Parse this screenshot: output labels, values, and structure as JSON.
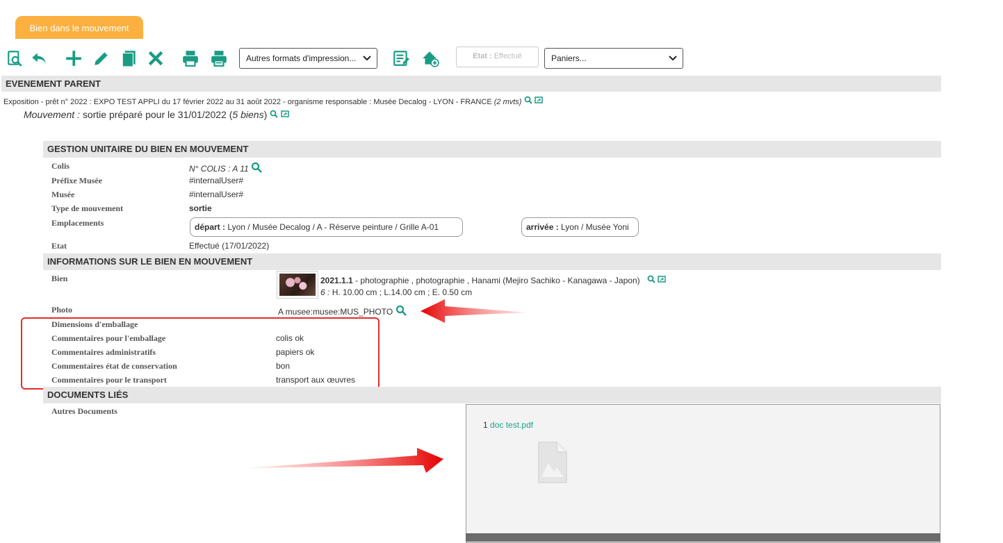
{
  "tab": {
    "label": "Bien dans le mouvement"
  },
  "toolbar": {
    "icons": [
      "preview-search-icon",
      "back-icon",
      "add-icon",
      "edit-icon",
      "copy-icon",
      "delete-icon",
      "print-icon",
      "print-alt-icon"
    ],
    "print_formats_select": "Autres formats d'impression...",
    "list_icon": "list-edit-icon",
    "home_add_icon": "home-add-icon",
    "etat_label": "Etat :",
    "etat_value": "Effectué",
    "paniers_select": "Paniers..."
  },
  "evenement_parent": {
    "header": "EVENEMENT PARENT",
    "exposition_text": "Exposition - prêt n° 2022 : EXPO TEST APPLI du 17 février 2022 au 31 août 2022 - organisme responsable : Musée Decalog - LYON - FRANCE",
    "exposition_mvts": "(2 mvts)",
    "mouvement_label": "Mouvement :",
    "mouvement_text": "sortie préparé pour le 31/01/2022 (",
    "mouvement_biens": "5 biens",
    "mouvement_close": ")"
  },
  "gestion": {
    "header": "GESTION UNITAIRE DU BIEN EN MOUVEMENT",
    "colis_label": "Colis",
    "colis_value": "N° COLIS :  A 11",
    "prefixe_label": "Préfixe Musée",
    "prefixe_value": "#internalUser#",
    "musee_label": "Musée",
    "musee_value": "#internalUser#",
    "type_label": "Type de mouvement",
    "type_value": "sortie",
    "emplacements_label": "Emplacements",
    "depart_label": "départ :",
    "depart_value": "Lyon / Musée Decalog / A - Réserve peinture / Grille A-01",
    "arrivee_label": "arrivée :",
    "arrivee_value": "Lyon / Musée Yoni",
    "etat_label": "Etat",
    "etat_value": "Effectué (17/01/2022)"
  },
  "informations": {
    "header": "INFORMATIONS SUR LE BIEN EN MOUVEMENT",
    "bien_label": "Bien",
    "bien_number": "2021.1.1",
    "bien_desc": "- photographie , photographie , Hanami (Mejiro Sachiko - Kanagawa - Japon)",
    "bien_dims_prefix": "6 :",
    "bien_dims": "H. 10.00 cm ; L.14.00 cm ; E. 0.50 cm",
    "photo_label": "Photo",
    "photo_value": "A musee:musee:MUS_PHOTO",
    "dimensions_label": "Dimensions d'emballage",
    "comm_emballage_label": "Commentaires pour l'emballage",
    "comm_emballage_value": "colis ok",
    "comm_admin_label": "Commentaires administratifs",
    "comm_admin_value": "papiers ok",
    "comm_etat_label": "Commentaires état de conservation",
    "comm_etat_value": "bon",
    "comm_transport_label": "Commentaires pour le transport",
    "comm_transport_value": "transport aux œuvres"
  },
  "documents": {
    "header": "DOCUMENTS LIÉS",
    "autres_label": "Autres Documents",
    "items": [
      {
        "index": "1",
        "name": "doc test.pdf"
      }
    ]
  },
  "colors": {
    "accent": "#1aa38a",
    "tab": "#fbb040",
    "highlight": "#e52b2b"
  }
}
